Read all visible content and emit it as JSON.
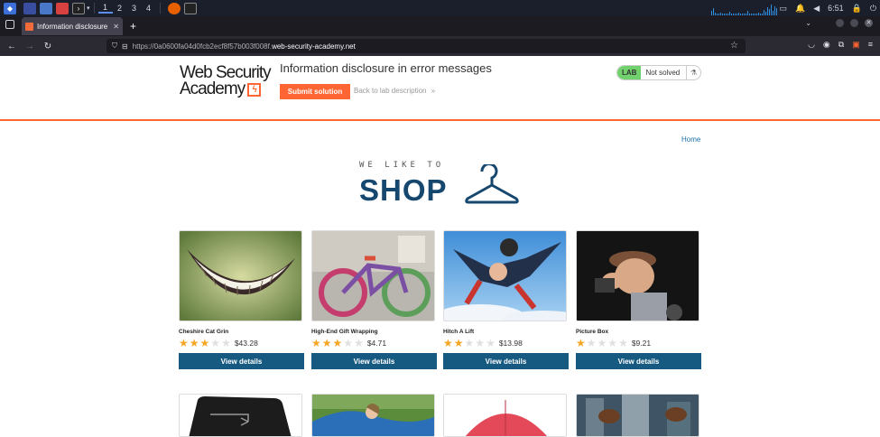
{
  "taskbar": {
    "workspaces": [
      "1",
      "2",
      "3",
      "4"
    ],
    "time": "6:51"
  },
  "browser": {
    "tab_title": "Information disclosure in",
    "url_prefix": "https://0a0600fa04d0fcb2ecf8f57b003f008f.",
    "url_host": "web-security-academy.net"
  },
  "lab": {
    "logo_line1": "Web Security",
    "logo_line2": "Academy",
    "title": "Information disclosure in error messages",
    "submit_label": "Submit solution",
    "back_label": "Back to lab description",
    "badge": "LAB",
    "status": "Not solved"
  },
  "nav": {
    "home": "Home"
  },
  "banner": {
    "small": "WE LIKE TO",
    "big": "SHOP"
  },
  "products": [
    {
      "name": "Cheshire Cat Grin",
      "stars": 3,
      "price": "$43.28",
      "button": "View details"
    },
    {
      "name": "High-End Gift Wrapping",
      "stars": 3,
      "price": "$4.71",
      "button": "View details"
    },
    {
      "name": "Hitch A Lift",
      "stars": 2,
      "price": "$13.98",
      "button": "View details"
    },
    {
      "name": "Picture Box",
      "stars": 1,
      "price": "$9.21",
      "button": "View details"
    }
  ],
  "colors": {
    "accent": "#ff6633",
    "button": "#165a82",
    "star": "#f5a623",
    "lab_badge": "#70d16d"
  }
}
